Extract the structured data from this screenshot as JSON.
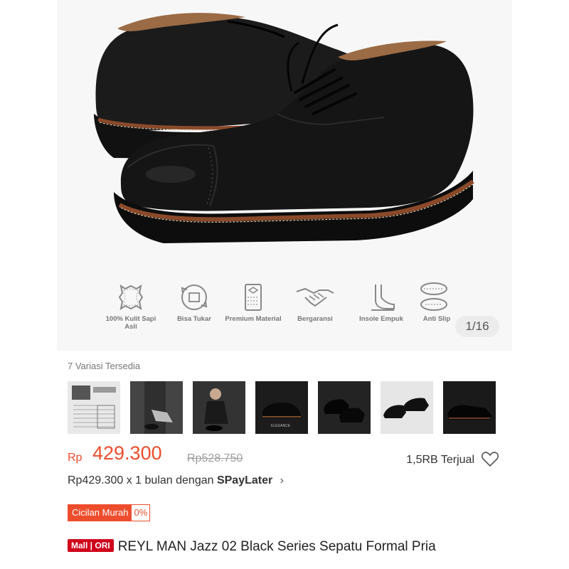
{
  "features": [
    {
      "icon": "leather-icon",
      "label": "100% Kulit Sapi Asli"
    },
    {
      "icon": "exchange-box-icon",
      "label": "Bisa Tukar"
    },
    {
      "icon": "premium-material-icon",
      "label": "Premium Material"
    },
    {
      "icon": "handshake-icon",
      "label": "Bergaransi"
    },
    {
      "icon": "insole-foot-icon",
      "label": "Insole Empuk"
    },
    {
      "icon": "anti-slip-sole-icon",
      "label": "Anti Slip"
    }
  ],
  "gallery": {
    "counter": "1/16"
  },
  "variants": {
    "title": "7 Variasi Tersedia",
    "count": 7,
    "thumb_text": "ELEGANCE"
  },
  "price": {
    "currency": "Rp",
    "current": "429.300",
    "original": "Rp528.750",
    "sold": "1,5RB Terjual"
  },
  "paylater": {
    "prefix": "Rp429.300 x 1 bulan dengan ",
    "brand": "SPayLater",
    "chevron": "›"
  },
  "installment": {
    "label": "Cicilan Murah",
    "rate": "0%"
  },
  "product": {
    "badge": "Mall | ORI",
    "title": "REYL MAN Jazz 02 Black Series Sepatu Formal Pria"
  },
  "colors": {
    "accent": "#ee4d2d",
    "mall_badge": "#d0011b"
  }
}
